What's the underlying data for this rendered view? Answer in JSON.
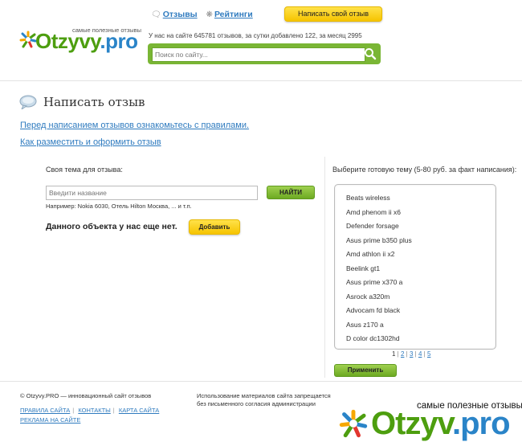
{
  "brand": {
    "name_main": "Otzyvy",
    "name_tld": ".pro",
    "tagline": "самые полезные отзывы",
    "colors": {
      "green": "#4d9e0f",
      "blue": "#2a84c8",
      "yellow": "#f6c400"
    }
  },
  "header": {
    "nav": [
      {
        "label": "Отзывы",
        "icon": "speech-bubble-icon"
      },
      {
        "label": "Рейтинги",
        "icon": "star-icon"
      }
    ],
    "write_review_label": "Написать свой отзыв",
    "stats": "У нас на сайте 645781 отзывов, за сутки добавлено 122, за месяц 2995",
    "search_placeholder": "Поиск по сайту..."
  },
  "page": {
    "title": "Написать отзыв",
    "rules_link": "Перед написанием отзывов ознакомьтесь с правилами.",
    "howto_link": "Как разместить и оформить отзыв"
  },
  "left": {
    "theme_label": "Своя тема для отзыва:",
    "theme_placeholder": "Введити название",
    "find_label": "НАЙТИ",
    "example": "Например: Nokia 6030, Отель Hilton Москва, ... и т.п.",
    "no_object": "Данного объекта у нас еще нет.",
    "add_label": "Добавить"
  },
  "right": {
    "choose_label": "Выберите готовую тему (5-80 руб. за факт написания):",
    "topics": [
      "Beats wireless",
      "Amd phenom ii x6",
      "Defender forsage",
      "Asus prime b350 plus",
      "Amd athlon ii x2",
      "Beelink gt1",
      "Asus prime x370 a",
      "Asrock a320m",
      "Advocam fd black",
      "Asus z170 a",
      "D color dc1302hd"
    ],
    "pages": [
      "1",
      "2",
      "3",
      "4",
      "5"
    ],
    "current_page": "1",
    "apply_label": "Применить"
  },
  "footer": {
    "copyright": "© Otzyvy.PRO — инновационный сайт отзывов",
    "links": [
      "ПРАВИЛА САЙТА",
      "КОНТАКТЫ",
      "КАРТА САЙТА",
      "РЕКЛАМА НА САЙТЕ"
    ],
    "usage_line1": "Использование материалов сайта запрещается",
    "usage_line2": "без письменного согласия администрации"
  },
  "watermark": {
    "tagline": "самые полезные отзывы",
    "name_main": "Otzyv",
    "name_tld": ".pro"
  }
}
